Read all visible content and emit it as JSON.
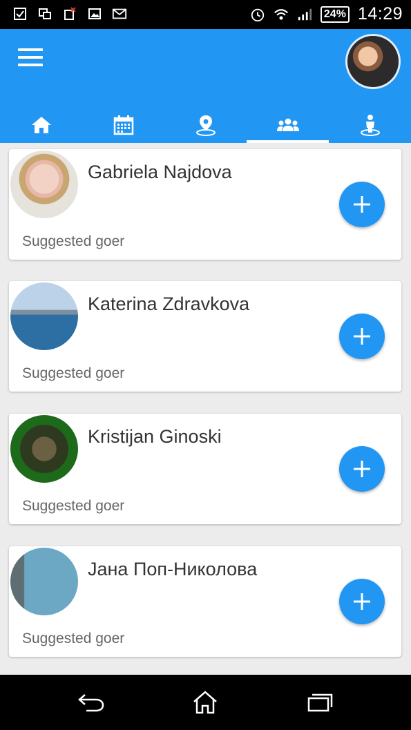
{
  "status_bar": {
    "time": "14:29",
    "battery": "24%",
    "left_icons": [
      "checkbox-icon",
      "window-icon",
      "sim-error-icon",
      "image-icon",
      "gmail-icon"
    ],
    "right_icons": [
      "alarm-icon",
      "wifi-icon",
      "signal-icon"
    ]
  },
  "app_bar": {
    "menu_icon": "menu-icon",
    "tabs": [
      {
        "icon": "home-icon",
        "active": false
      },
      {
        "icon": "calendar-icon",
        "active": false
      },
      {
        "icon": "location-icon",
        "active": false
      },
      {
        "icon": "people-icon",
        "active": true
      },
      {
        "icon": "person-pin-icon",
        "active": false
      }
    ],
    "accent": "#2196f3"
  },
  "cards": [
    {
      "name": "Gabriela Najdova",
      "subtitle": "Suggested goer"
    },
    {
      "name": "Katerina Zdravkova",
      "subtitle": "Suggested goer"
    },
    {
      "name": "Kristijan Ginoski",
      "subtitle": "Suggested goer"
    },
    {
      "name": "Јана Поп-Николова",
      "subtitle": "Suggested goer"
    }
  ],
  "nav_bar": {
    "icons": [
      "back-icon",
      "home-icon",
      "recents-icon"
    ]
  }
}
